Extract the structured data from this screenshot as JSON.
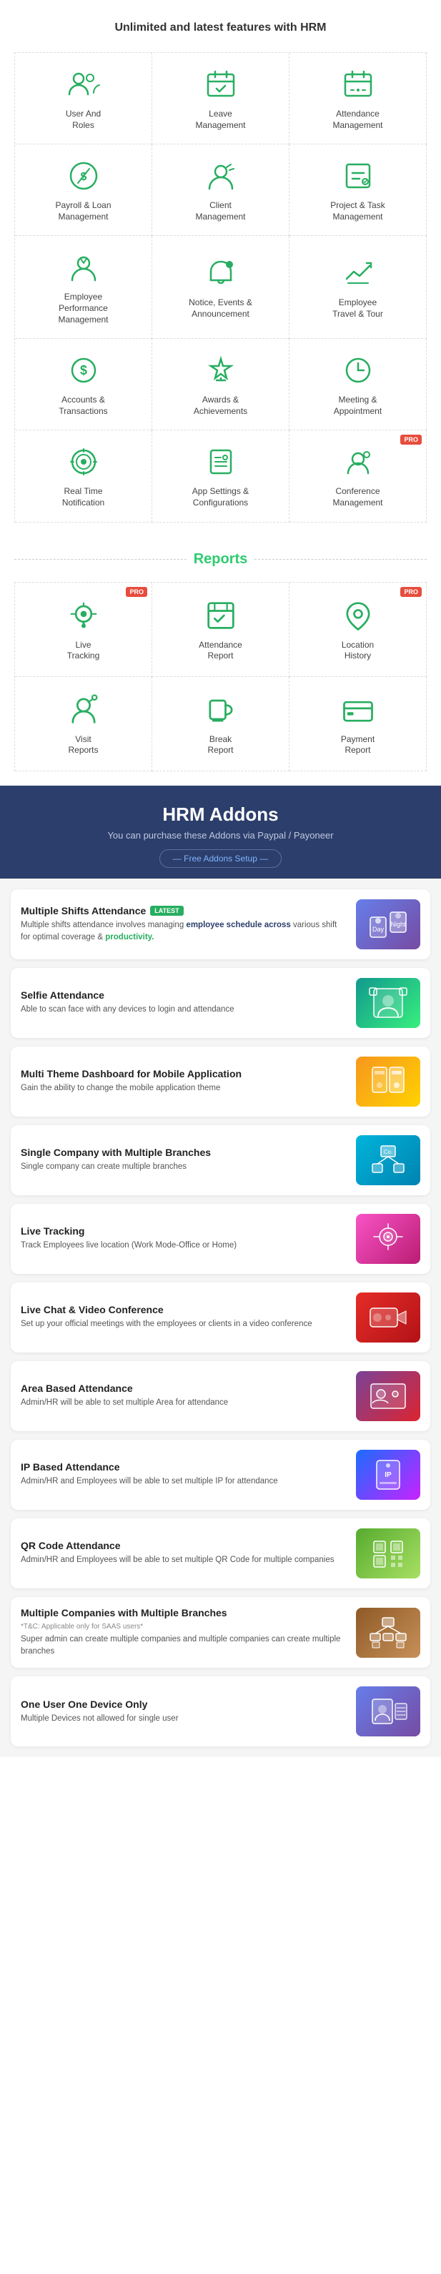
{
  "features": {
    "title": "Unlimited and latest features with HRM",
    "items": [
      {
        "id": "user-roles",
        "label": "User And\nRoles",
        "icon": "users",
        "pro": false
      },
      {
        "id": "leave",
        "label": "Leave\nManagement",
        "icon": "leave",
        "pro": false
      },
      {
        "id": "attendance",
        "label": "Attendance\nManagement",
        "icon": "attendance",
        "pro": false
      },
      {
        "id": "payroll",
        "label": "Payroll & Loan\nManagement",
        "icon": "payroll",
        "pro": false
      },
      {
        "id": "client",
        "label": "Client\nManagement",
        "icon": "client",
        "pro": false
      },
      {
        "id": "project",
        "label": "Project & Task\nManagement",
        "icon": "project",
        "pro": false
      },
      {
        "id": "employee-perf",
        "label": "Employee\nPerformance\nManagement",
        "icon": "performance",
        "pro": false
      },
      {
        "id": "notice",
        "label": "Notice, Events &\nAnnouncement",
        "icon": "notice",
        "pro": false
      },
      {
        "id": "travel",
        "label": "Employee\nTravel & Tour",
        "icon": "travel",
        "pro": false
      },
      {
        "id": "accounts",
        "label": "Accounts &\nTransactions",
        "icon": "accounts",
        "pro": false
      },
      {
        "id": "awards",
        "label": "Awards &\nAchievements",
        "icon": "awards",
        "pro": false
      },
      {
        "id": "meeting",
        "label": "Meeting &\nAppointment",
        "icon": "meeting",
        "pro": false
      },
      {
        "id": "realtime",
        "label": "Real Time\nNotification",
        "icon": "notification",
        "pro": false
      },
      {
        "id": "appsettings",
        "label": "App Settings &\nConfigurations",
        "icon": "settings",
        "pro": false
      },
      {
        "id": "conference",
        "label": "PRO Conference\nManagement",
        "icon": "conference",
        "pro": true
      }
    ]
  },
  "reports": {
    "title": "Reports",
    "items": [
      {
        "id": "live-tracking",
        "label": "Live\nTracking",
        "icon": "tracking",
        "pro": true
      },
      {
        "id": "attendance-report",
        "label": "Attendance\nReport",
        "icon": "attendance-report",
        "pro": false
      },
      {
        "id": "location-history",
        "label": "Location\nHistory",
        "icon": "location",
        "pro": true
      },
      {
        "id": "visit-reports",
        "label": "Visit\nReports",
        "icon": "visit",
        "pro": false
      },
      {
        "id": "break-report",
        "label": "Break\nReport",
        "icon": "break",
        "pro": false
      },
      {
        "id": "payment-report",
        "label": "Payment\nReport",
        "icon": "payment",
        "pro": false
      }
    ]
  },
  "addons": {
    "section_title": "HRM Addons",
    "section_subtitle": "You can purchase these Addons via Paypal / Payoneer",
    "free_label": "— Free Addons Setup —",
    "cards": [
      {
        "id": "multiple-shifts",
        "name": "Multiple Shifts Attendance",
        "badge": "LATEST",
        "desc": "Multiple shifts attendance involves managing employee schedule across various shift for optimal coverage & productivity.",
        "img_theme": "img-blue"
      },
      {
        "id": "selfie-attendance",
        "name": "Selfie Attendance",
        "badge": "",
        "desc": "Able to scan face with any devices to login and attendance",
        "img_theme": "img-green"
      },
      {
        "id": "multi-theme",
        "name": "Multi Theme Dashboard for Mobile Application",
        "badge": "",
        "desc": "Gain the ability to change the mobile application theme",
        "img_theme": "img-orange"
      },
      {
        "id": "single-company-branches",
        "name": "Single Company with Multiple Branches",
        "badge": "",
        "desc": "Single company can create multiple branches",
        "img_theme": "img-teal"
      },
      {
        "id": "live-tracking",
        "name": "Live Tracking",
        "badge": "",
        "desc": "Track Employees live location (Work Mode-Office or Home)",
        "img_theme": "img-pink"
      },
      {
        "id": "live-chat-video",
        "name": "Live Chat & Video Conference",
        "badge": "",
        "desc": "Set up your official meetings with the employees or clients in a video conference",
        "img_theme": "img-red"
      },
      {
        "id": "area-attendance",
        "name": "Area Based Attendance",
        "badge": "",
        "desc": "Admin/HR will be able to set multiple Area for attendance",
        "img_theme": "img-purple"
      },
      {
        "id": "ip-attendance",
        "name": "IP Based Attendance",
        "badge": "",
        "desc": "Admin/HR and Employees will be able to set multiple IP for attendance",
        "img_theme": "img-cyan"
      },
      {
        "id": "qr-attendance",
        "name": "QR Code Attendance",
        "badge": "",
        "desc": "Admin/HR and Employees will be able to set multiple QR Code for multiple companies",
        "img_theme": "img-lime"
      },
      {
        "id": "multiple-companies-branches",
        "name": "Multiple Companies with Multiple Branches",
        "badge": "",
        "tc": "*T&C: Applicable only for SAAS users*",
        "desc": "Super admin can create multiple companies and multiple companies can create multiple branches",
        "img_theme": "img-brown"
      },
      {
        "id": "one-device",
        "name": "One User One Device Only",
        "badge": "",
        "desc": "Multiple Devices not allowed for single user",
        "img_theme": "img-blue"
      }
    ]
  }
}
